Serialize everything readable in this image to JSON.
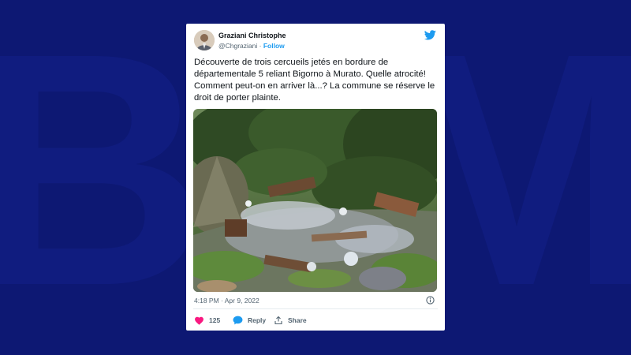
{
  "background": {
    "color": "#0d1873",
    "watermark": "BFM"
  },
  "tweet": {
    "author": {
      "name": "Graziani Christophe",
      "handle": "@Chgraziani",
      "separator": "·",
      "follow_label": "Follow"
    },
    "text": "Découverte de trois cercueils jetés en bordure de départementale 5 reliant Bigorno à Murato. Quelle atrocité! Comment peut-on en arriver là...? La commune se réserve le droit de porter plainte.",
    "timestamp": "4:18 PM · Apr 9, 2022",
    "actions": {
      "like_count": "125",
      "reply_label": "Reply",
      "share_label": "Share"
    },
    "icons": [
      "twitter-bird-icon",
      "info-icon",
      "heart-icon",
      "reply-bubble-icon",
      "share-icon"
    ],
    "colors": {
      "brand": "#1d9bf0",
      "like": "#f91880",
      "text": "#0f1419",
      "muted": "#536471"
    }
  }
}
